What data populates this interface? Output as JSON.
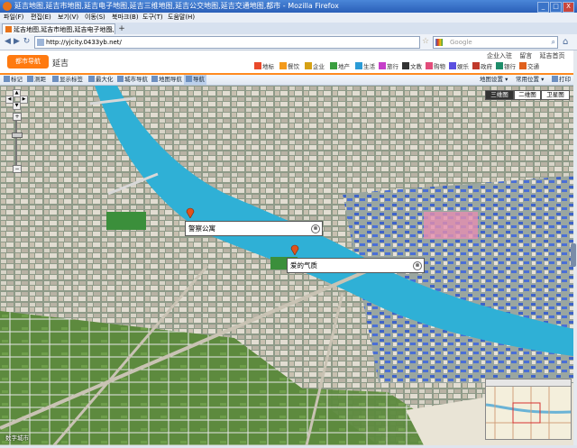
{
  "window": {
    "title": "延吉地图,延吉市地图,延吉电子地图,延吉三维地图,延吉公交地图,延吉交通地图,都市 - Mozilla Firefox",
    "minimize": "_",
    "maximize": "□",
    "close": "X"
  },
  "menu": [
    "파일(F)",
    "편집(E)",
    "보기(V)",
    "이동(S)",
    "북마크(B)",
    "도구(T)",
    "도움말(H)"
  ],
  "tab": {
    "label": "延吉地图,延吉市地图,延吉电子地图,延...",
    "close": "x",
    "new": "+"
  },
  "nav": {
    "back": "◀",
    "forward": "▶",
    "reload": "↻",
    "stop": "✕",
    "url": "http://yjcity.0433yb.net/",
    "search_placeholder": "Google"
  },
  "site": {
    "logo": "都市导航",
    "city": "延吉",
    "toplinks": [
      "企业入驻",
      "留言",
      "延吉首页"
    ],
    "categories": [
      {
        "label": "地标",
        "color": "#e94a2b"
      },
      {
        "label": "餐饮",
        "color": "#f39a1c"
      },
      {
        "label": "企业",
        "color": "#d6a114"
      },
      {
        "label": "地产",
        "color": "#3a9e3f"
      },
      {
        "label": "生活",
        "color": "#2b9bd6"
      },
      {
        "label": "旅行",
        "color": "#c53fc9"
      },
      {
        "label": "文教",
        "color": "#333333"
      },
      {
        "label": "购物",
        "color": "#e24c7a"
      },
      {
        "label": "娱乐",
        "color": "#5b4fe0"
      },
      {
        "label": "政府",
        "color": "#c0392b"
      },
      {
        "label": "银行",
        "color": "#1f8d6a"
      },
      {
        "label": "交通",
        "color": "#e0601d"
      }
    ],
    "toolbar": [
      "标记",
      "测距",
      "显示标签",
      "最大化",
      "城市导航",
      "地图导航",
      "导航"
    ],
    "toolbar_right": [
      "地图设置",
      "常用位置",
      "打印"
    ],
    "maptypes": [
      "三维图",
      "二维图",
      "卫星图"
    ],
    "labels": [
      "警察公寓",
      "爱的气质"
    ],
    "powered": "数字城市"
  }
}
